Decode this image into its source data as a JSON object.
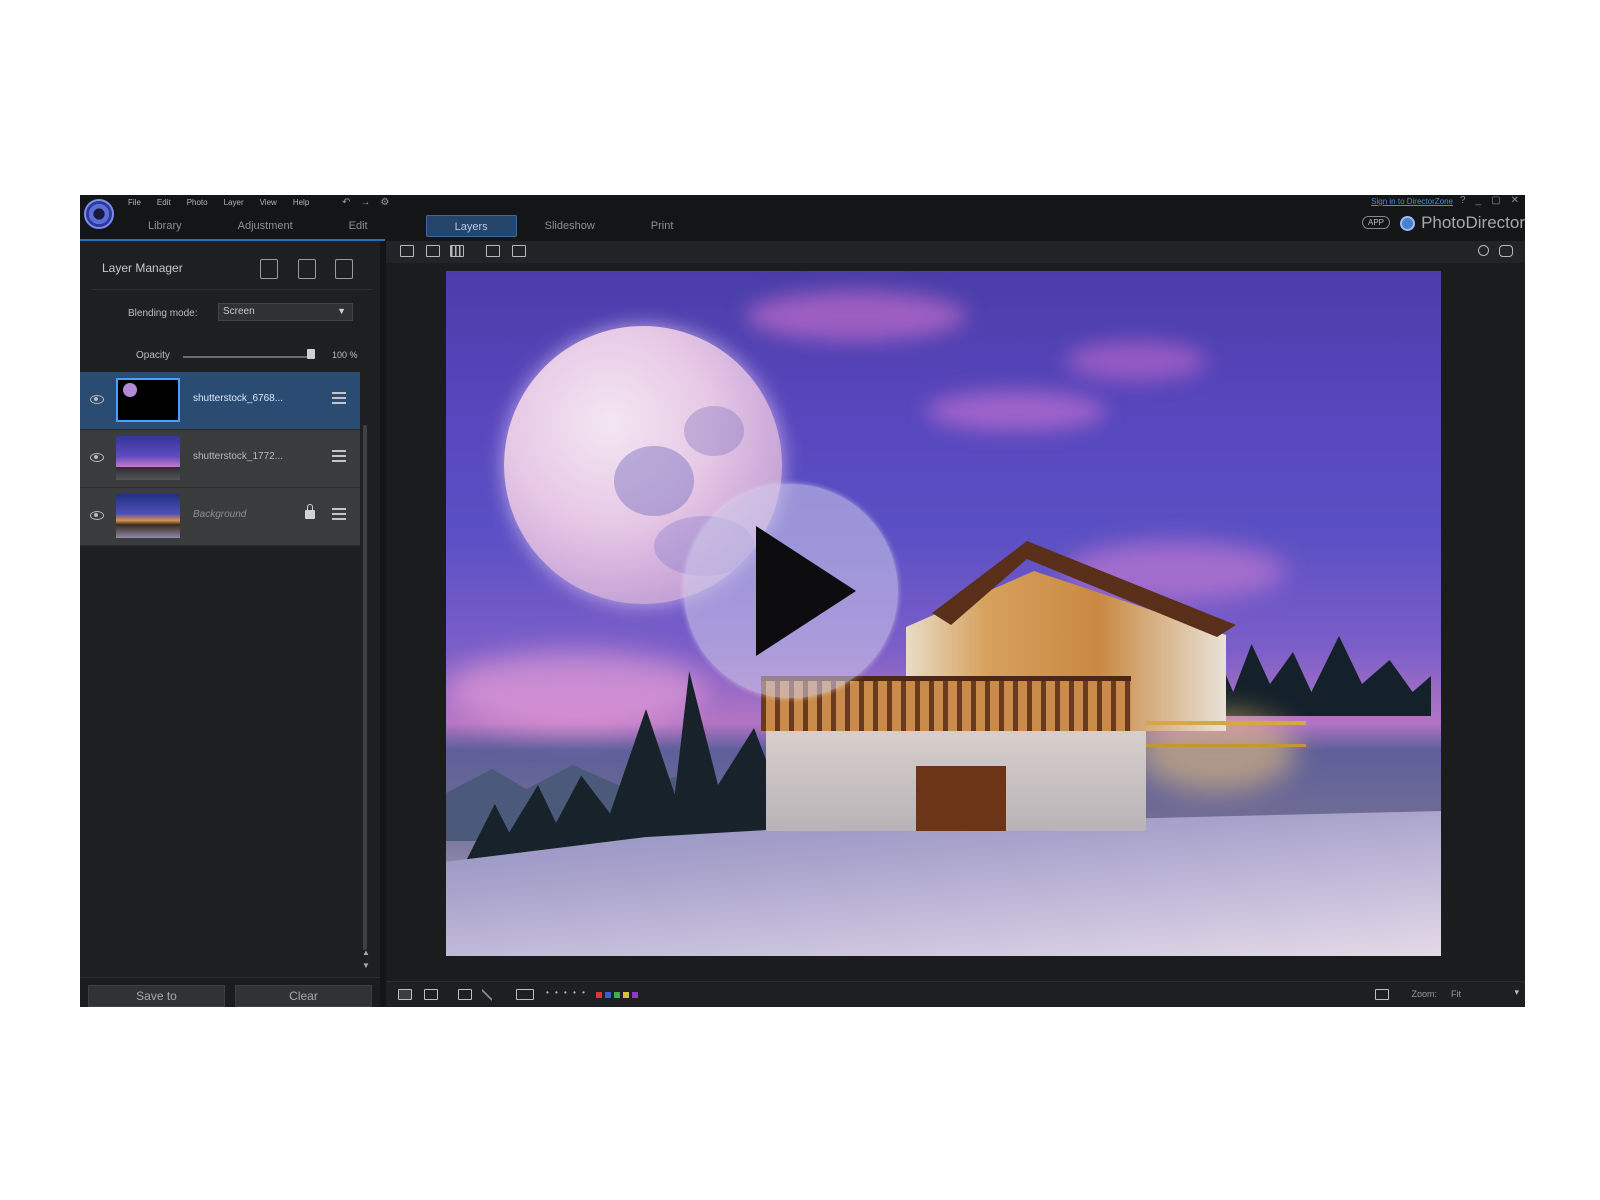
{
  "menu": [
    "File",
    "Edit",
    "Photo",
    "Layer",
    "View",
    "Help"
  ],
  "menu_extras": [
    "↶",
    "→",
    "⚙"
  ],
  "mode_tabs": {
    "library": "Library",
    "adjustment": "Adjustment",
    "edit": "Edit",
    "layers": "Layers",
    "slideshow": "Slideshow",
    "print": "Print"
  },
  "signin": "Sign in to DirectorZone",
  "window_controls": [
    "?",
    "_",
    "▢",
    "✕"
  ],
  "app_badge": "APP",
  "brand": "PhotoDirector",
  "layer_panel": {
    "title": "Layer Manager",
    "blending_label": "Blending mode:",
    "blending_value": "Screen",
    "opacity_label": "Opacity",
    "opacity_value": "100 %",
    "opacity_level": 1.0,
    "layers": [
      {
        "name": "shutterstock_6768...",
        "selected": true,
        "locked": false
      },
      {
        "name": "shutterstock_1772...",
        "selected": false,
        "locked": false
      },
      {
        "name": "Background",
        "selected": false,
        "locked": true
      }
    ]
  },
  "footer": {
    "save_label": "Save to",
    "clear_label": "Clear"
  },
  "bottom_bar": {
    "rating": "• • • • •",
    "colors": [
      "#d43a3a",
      "#3a5fd4",
      "#3ab04a",
      "#d4c23a",
      "#8a3ad4"
    ],
    "zoom_label": "Zoom:",
    "zoom_value": "Fit",
    "zoom_arrow": "▾"
  },
  "scroll": {
    "up": "▲",
    "down": "▼"
  }
}
